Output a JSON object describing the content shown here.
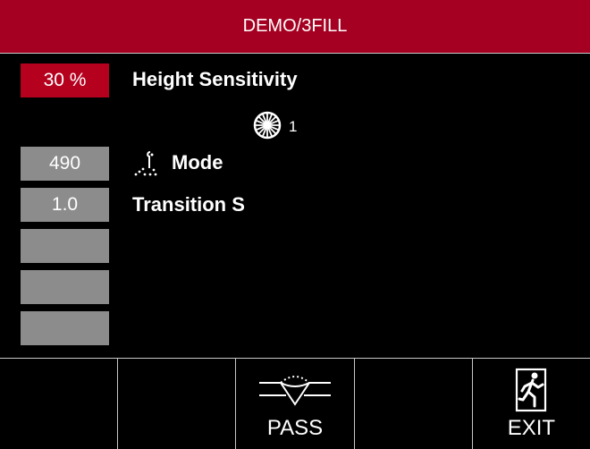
{
  "title": "DEMO/3FILL",
  "parameters": [
    {
      "value": "30 %",
      "label": "Height Sensitivity",
      "active": true
    },
    {
      "value": "490",
      "label": "Mode",
      "icon": "torch-spatter-icon",
      "active": false
    },
    {
      "value": "1.0",
      "label": "Transition S",
      "active": false
    },
    {
      "value": "",
      "label": "",
      "active": false
    },
    {
      "value": "",
      "label": "",
      "active": false
    },
    {
      "value": "",
      "label": "",
      "active": false
    }
  ],
  "wheel": {
    "icon": "wheel-icon",
    "value": "1"
  },
  "softkeys": [
    {
      "label": "",
      "icon": ""
    },
    {
      "label": "",
      "icon": ""
    },
    {
      "label": "PASS",
      "icon": "weld-pass-icon"
    },
    {
      "label": "",
      "icon": ""
    },
    {
      "label": "EXIT",
      "icon": "exit-door-icon"
    }
  ],
  "colors": {
    "titlebar": "#a50021",
    "active_value": "#b5001e",
    "inactive_value": "#8c8c8c",
    "background": "#000000",
    "divider": "#c8c8c8"
  }
}
